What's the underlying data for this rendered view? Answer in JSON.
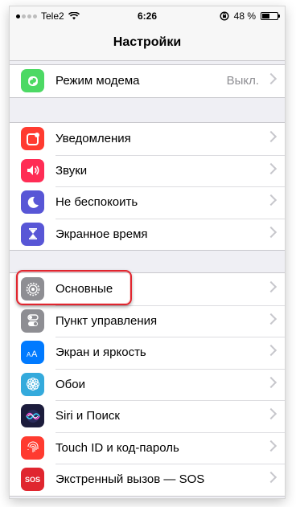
{
  "status": {
    "carrier": "Tele2",
    "time": "6:26",
    "battery": "48 %",
    "battery_level": 0.48
  },
  "nav": {
    "title": "Настройки"
  },
  "groups": [
    {
      "rows": [
        {
          "label": "Режим модема",
          "value": "Выкл.",
          "icon": "link-icon",
          "color": "#4cd964"
        }
      ]
    },
    {
      "rows": [
        {
          "label": "Уведомления",
          "icon": "notifications-icon",
          "color": "#ff3b30"
        },
        {
          "label": "Звуки",
          "icon": "speaker-icon",
          "color": "#ff2d55"
        },
        {
          "label": "Не беспокоить",
          "icon": "moon-icon",
          "color": "#5856d6"
        },
        {
          "label": "Экранное время",
          "icon": "hourglass-icon",
          "color": "#5856d6"
        }
      ]
    },
    {
      "rows": [
        {
          "label": "Основные",
          "icon": "gear-icon",
          "color": "#8e8e93"
        },
        {
          "label": "Пункт управления",
          "icon": "toggles-icon",
          "color": "#8e8e93"
        },
        {
          "label": "Экран и яркость",
          "icon": "text-size-icon",
          "color": "#007aff"
        },
        {
          "label": "Обои",
          "icon": "flower-icon",
          "color": "#34aadc"
        },
        {
          "label": "Siri и Поиск",
          "icon": "siri-icon",
          "color": "#1c1c3c"
        },
        {
          "label": "Touch ID и код-пароль",
          "icon": "fingerprint-icon",
          "color": "#ff3b30"
        },
        {
          "label": "Экстренный вызов — SOS",
          "icon": "sos-icon",
          "color": "#e0262f",
          "icon_text": "SOS"
        }
      ]
    }
  ]
}
